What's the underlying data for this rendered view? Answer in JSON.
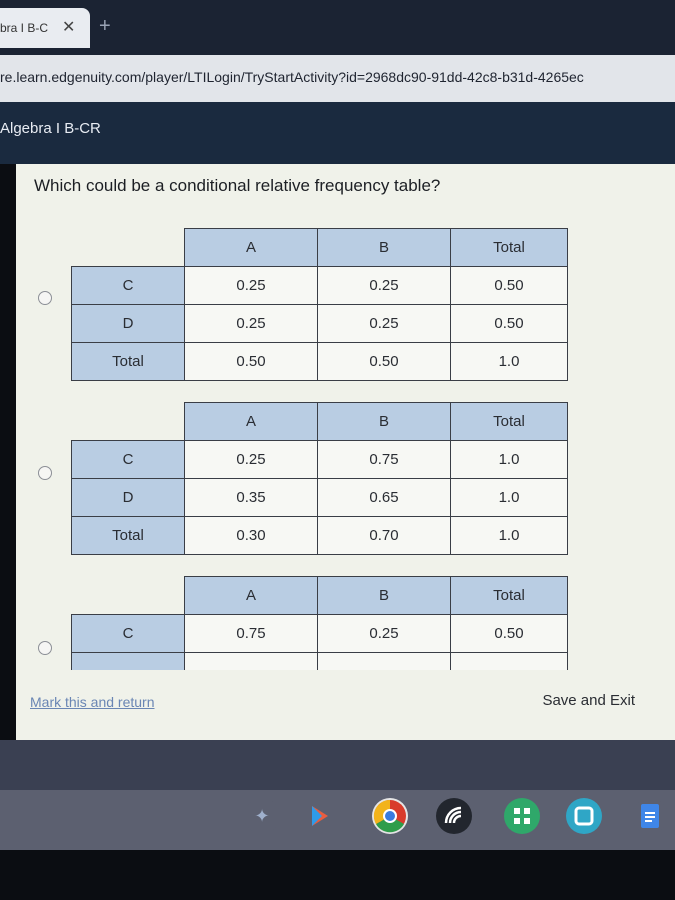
{
  "browser": {
    "tab_title": "bra I B-C",
    "tab_close": "✕",
    "new_tab": "+",
    "url": "re.learn.edgenuity.com/player/LTILogin/TryStartActivity?id=2968dc90-91dd-42c8-b31d-4265ec"
  },
  "course": {
    "title": "Algebra I B-CR"
  },
  "question": {
    "text": "Which could be a conditional relative frequency table?"
  },
  "options": [
    {
      "headers": [
        "A",
        "B",
        "Total"
      ],
      "rows": [
        {
          "label": "C",
          "values": [
            "0.25",
            "0.25",
            "0.50"
          ]
        },
        {
          "label": "D",
          "values": [
            "0.25",
            "0.25",
            "0.50"
          ]
        },
        {
          "label": "Total",
          "values": [
            "0.50",
            "0.50",
            "1.0"
          ]
        }
      ]
    },
    {
      "headers": [
        "A",
        "B",
        "Total"
      ],
      "rows": [
        {
          "label": "C",
          "values": [
            "0.25",
            "0.75",
            "1.0"
          ]
        },
        {
          "label": "D",
          "values": [
            "0.35",
            "0.65",
            "1.0"
          ]
        },
        {
          "label": "Total",
          "values": [
            "0.30",
            "0.70",
            "1.0"
          ]
        }
      ]
    },
    {
      "headers": [
        "A",
        "B",
        "Total"
      ],
      "rows": [
        {
          "label": "C",
          "values": [
            "0.75",
            "0.25",
            "0.50"
          ]
        }
      ]
    }
  ],
  "footer": {
    "mark_link": "Mark this and return",
    "save_exit": "Save and Exit"
  },
  "shelf": {
    "icons": [
      "launcher-icon",
      "play-store-icon",
      "chrome-icon",
      "wifi-app-icon",
      "apps-grid-icon",
      "files-icon",
      "docs-icon"
    ]
  }
}
